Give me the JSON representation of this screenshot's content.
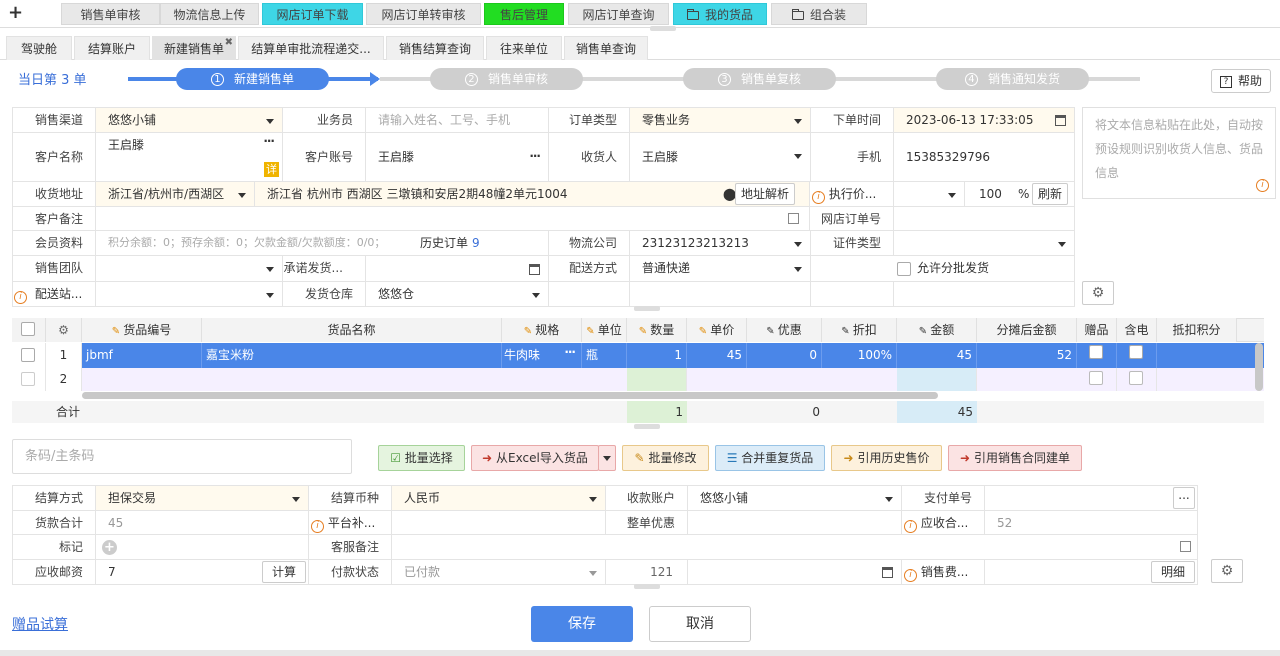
{
  "top_tabs": [
    "销售单审核",
    "物流信息上传",
    "网店订单下载",
    "网店订单转审核",
    "售后管理",
    "网店订单查询",
    "我的货品",
    "组合装"
  ],
  "sub_tabs": [
    "驾驶舱",
    "结算账户",
    "新建销售单",
    "结算单审批流程递交...",
    "销售结算查询",
    "往来单位",
    "销售单查询"
  ],
  "today": "当日第 3 单",
  "steps": [
    {
      "num": "1",
      "label": "新建销售单"
    },
    {
      "num": "2",
      "label": "销售单审核"
    },
    {
      "num": "3",
      "label": "销售单复核"
    },
    {
      "num": "4",
      "label": "销售通知发货"
    }
  ],
  "help": "帮助",
  "form": {
    "channel_label": "销售渠道",
    "channel": "悠悠小铺",
    "salesman_label": "业务员",
    "salesman_ph": "请输入姓名、工号、手机",
    "order_type_label": "订单类型",
    "order_type": "零售业务",
    "order_time_label": "下单时间",
    "order_time": "2023-06-13 17:33:05",
    "customer_label": "客户名称",
    "customer": "王启滕",
    "detail_badge": "详",
    "account_label": "客户账号",
    "account": "王启滕",
    "receiver_label": "收货人",
    "receiver": "王启滕",
    "phone_label": "手机",
    "phone": "15385329796",
    "addr_label": "收货地址",
    "addr_region": "浙江省/杭州市/西湖区",
    "addr_detail": "浙江省 杭州市 西湖区  三墩镇和安居2期48幢2单元1004",
    "parse_btn": "地址解析",
    "exec_price_label": "执行价...",
    "discount_pct": "100",
    "pct_sign": "%",
    "refresh_btn": "刷新",
    "remark_label": "客户备注",
    "shop_order_label": "网店订单号",
    "member_label": "会员资料",
    "member_info": "积分余额：0；预存余额：0；欠款金额/欠款额度：0/0；",
    "history_label": "历史订单",
    "history_count": "9",
    "logistics_label": "物流公司",
    "logistics": "23123123213213",
    "cert_label": "证件类型",
    "team_label": "销售团队",
    "promise_label": "承诺发货...",
    "delivery_label": "配送方式",
    "delivery": "普通快递",
    "split_label": "允许分批发货",
    "station_label": "配送站...",
    "warehouse_label": "发货仓库",
    "warehouse": "悠悠仓",
    "paste_ph": "将文本信息粘贴在此处，自动按预设规则识别收货人信息、货品信息"
  },
  "grid": {
    "headers": [
      "货品编号",
      "货品名称",
      "规格",
      "单位",
      "数量",
      "单价",
      "优惠",
      "折扣",
      "金额",
      "分摊后金额",
      "赠品",
      "含电",
      "抵扣积分"
    ],
    "rows": [
      {
        "idx": "1",
        "code": "jbmf",
        "name": "嘉宝米粉",
        "spec": "牛肉味",
        "unit": "瓶",
        "qty": "1",
        "price": "45",
        "disc": "0",
        "rate": "100%",
        "amount": "45",
        "alloc": "52"
      },
      {
        "idx": "2",
        "code": "",
        "name": "",
        "spec": "",
        "unit": "",
        "qty": "",
        "price": "",
        "disc": "",
        "rate": "",
        "amount": "",
        "alloc": ""
      }
    ],
    "total_label": "合计",
    "total_qty": "1",
    "total_disc": "0",
    "total_amount": "45"
  },
  "barcode_ph": "条码/主条码",
  "toolbar": [
    "批量选择",
    "从Excel导入货品",
    "批量修改",
    "合并重复货品",
    "引用历史售价",
    "引用销售合同建单"
  ],
  "settle": {
    "method_label": "结算方式",
    "method": "担保交易",
    "currency_label": "结算币种",
    "currency": "人民币",
    "account_label": "收款账户",
    "account": "悠悠小铺",
    "payno_label": "支付单号",
    "goods_total_label": "货款合计",
    "goods_total": "45",
    "subsidy_label": "平台补...",
    "whole_disc_label": "整单优惠",
    "receivable_label": "应收合...",
    "receivable": "52",
    "mark_label": "标记",
    "cs_remark_label": "客服备注",
    "postage_label": "应收邮资",
    "postage": "7",
    "calc_btn": "计算",
    "paystatus_label": "付款状态",
    "paystatus": "已付款",
    "pay_amount": "121",
    "salesfee_label": "销售费...",
    "detail_btn": "明细"
  },
  "gift_calc": "赠品试算",
  "save": "保存",
  "cancel": "取消",
  "colors": {
    "accent": "#4a86e8",
    "cyan": "#3ed6e6",
    "green": "#22dd22"
  }
}
